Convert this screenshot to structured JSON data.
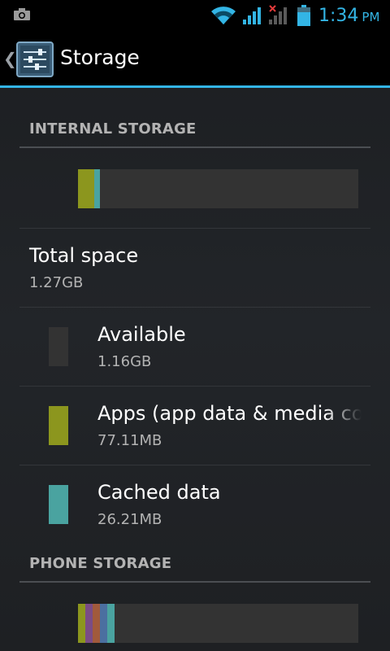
{
  "status_bar": {
    "time": "1:34",
    "ampm": "PM",
    "icons": [
      "camera-icon",
      "wifi-icon",
      "signal-icon",
      "signal-no-service-icon",
      "battery-icon"
    ],
    "accent": "#33b5e5"
  },
  "action_bar": {
    "title": "Storage",
    "icons": [
      "back-chevron-icon",
      "settings-sliders-icon"
    ]
  },
  "internal_storage": {
    "header": "INTERNAL STORAGE",
    "usage_bar": [
      {
        "name": "Apps (app data & media content)",
        "fraction": 0.059,
        "color": "#8c961e"
      },
      {
        "name": "Cached data",
        "fraction": 0.02,
        "color": "#4aa3a0"
      },
      {
        "name": "Available",
        "fraction": 0.913,
        "color": "#333333"
      }
    ],
    "total": {
      "label": "Total space",
      "value": "1.27GB"
    },
    "items": [
      {
        "label": "Available",
        "value": "1.16GB",
        "color": "#333333"
      },
      {
        "label": "Apps (app data & media content)",
        "value": "77.11MB",
        "color": "#8c961e"
      },
      {
        "label": "Cached data",
        "value": "26.21MB",
        "color": "#4aa3a0"
      }
    ]
  },
  "phone_storage": {
    "header": "PHONE STORAGE",
    "usage_bar": [
      {
        "fraction": 0.026,
        "color": "#8c961e"
      },
      {
        "fraction": 0.026,
        "color": "#7a4c86"
      },
      {
        "fraction": 0.026,
        "color": "#a15a3c"
      },
      {
        "fraction": 0.026,
        "color": "#4b6fa0"
      },
      {
        "fraction": 0.026,
        "color": "#4aa3a0"
      },
      {
        "fraction": 0.87,
        "color": "#333333"
      }
    ]
  }
}
